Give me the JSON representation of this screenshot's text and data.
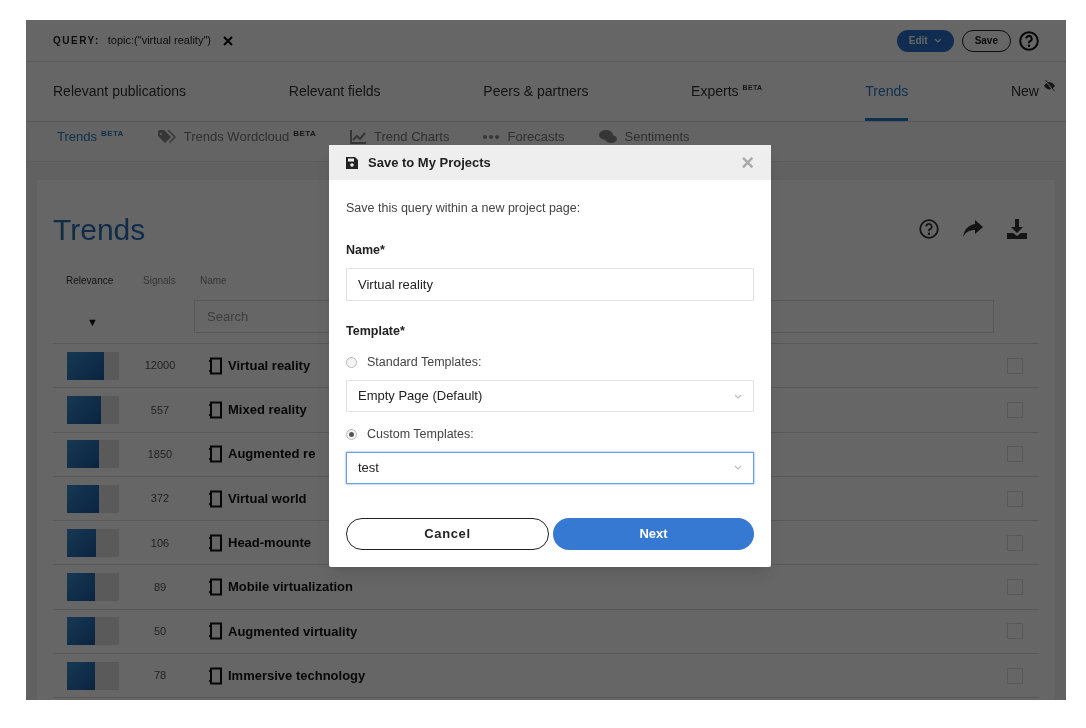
{
  "query": {
    "label": "QUERY:",
    "value": "topic:(\"virtual reality\")"
  },
  "header_buttons": {
    "edit": "Edit",
    "save": "Save"
  },
  "nav_tabs": [
    {
      "label": "Relevant publications",
      "selected": false
    },
    {
      "label": "Relevant fields",
      "selected": false
    },
    {
      "label": "Peers & partners",
      "selected": false
    },
    {
      "label": "Experts",
      "badge": "BETA",
      "selected": false
    },
    {
      "label": "Trends",
      "selected": true
    },
    {
      "label": "New",
      "kind": "hidden",
      "selected": false
    }
  ],
  "sub_tabs": [
    {
      "label": "Trends",
      "badge": "BETA",
      "kind": "plain",
      "selected": true
    },
    {
      "label": "Trends Wordcloud",
      "badge": "BETA",
      "kind": "tags",
      "selected": false
    },
    {
      "label": "Trend Charts",
      "kind": "chart",
      "selected": false
    },
    {
      "label": "Forecasts",
      "kind": "dots",
      "selected": false
    },
    {
      "label": "Sentiments",
      "kind": "comments",
      "selected": false
    }
  ],
  "page_title": "Trends",
  "table": {
    "columns": [
      "Relevance",
      "Signals",
      "Name"
    ],
    "sort_arrow": "▼",
    "search_placeholder": "Search",
    "rows": [
      {
        "level": 0.71,
        "signals": "12000",
        "name": "Virtual reality",
        "checked": false
      },
      {
        "level": 0.65,
        "signals": "557",
        "name": "Mixed reality",
        "checked": false
      },
      {
        "level": 0.61,
        "signals": "1850",
        "name": "Augmented re",
        "checked": false
      },
      {
        "level": 0.61,
        "signals": "372",
        "name": "Virtual world",
        "checked": false
      },
      {
        "level": 0.55,
        "signals": "106",
        "name": "Head-mounte",
        "checked": false
      },
      {
        "level": 0.53,
        "signals": "89",
        "name": "Mobile virtualization",
        "checked": false
      },
      {
        "level": 0.53,
        "signals": "50",
        "name": "Augmented virtuality",
        "checked": false
      },
      {
        "level": 0.53,
        "signals": "78",
        "name": "Immersive technology",
        "checked": false
      }
    ]
  },
  "dialog": {
    "title": "Save to My Projects",
    "close": "×",
    "intro": "Save this query within a new project page:",
    "name_label": "Name*",
    "name_value": "Virtual reality",
    "template_label": "Template*",
    "templates": [
      {
        "label": "Standard Templates:",
        "value": "Empty Page (Default)",
        "selected": false
      },
      {
        "label": "Custom Templates:",
        "value": "test",
        "selected": true
      }
    ],
    "cancel": "Cancel",
    "next": "Next"
  }
}
